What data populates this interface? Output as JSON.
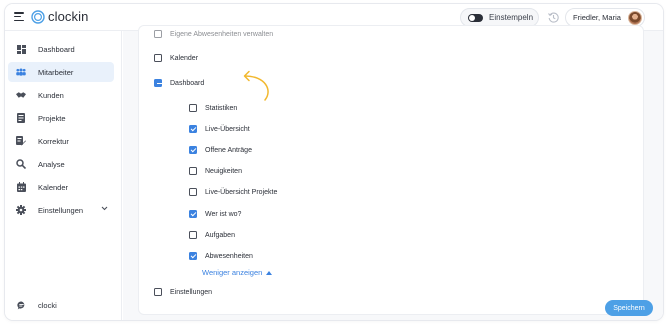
{
  "app": {
    "name": "clockin"
  },
  "header": {
    "clock_in_label": "Einstempeln",
    "user_name": "Friedler, Maria"
  },
  "sidebar": {
    "items": [
      {
        "label": "Dashboard",
        "icon": "dashboard-icon",
        "active": false
      },
      {
        "label": "Mitarbeiter",
        "icon": "users-icon",
        "active": true
      },
      {
        "label": "Kunden",
        "icon": "handshake-icon",
        "active": false
      },
      {
        "label": "Projekte",
        "icon": "projects-icon",
        "active": false
      },
      {
        "label": "Korrektur",
        "icon": "correction-icon",
        "active": false
      },
      {
        "label": "Analyse",
        "icon": "analysis-icon",
        "active": false
      },
      {
        "label": "Kalender",
        "icon": "calendar-icon",
        "active": false
      },
      {
        "label": "Einstellungen",
        "icon": "gear-icon",
        "active": false
      }
    ],
    "footer_label": "clocki"
  },
  "permissions": {
    "top_cut_label": "Eigene Abwesenheiten verwalten",
    "kalender": {
      "label": "Kalender",
      "checked": false
    },
    "dashboard": {
      "label": "Dashboard",
      "state": "partial"
    },
    "dashboard_children": [
      {
        "label": "Statistiken",
        "checked": false
      },
      {
        "label": "Live-Übersicht",
        "checked": true
      },
      {
        "label": "Offene Anträge",
        "checked": true
      },
      {
        "label": "Neuigkeiten",
        "checked": false
      },
      {
        "label": "Live-Übersicht Projekte",
        "checked": false
      },
      {
        "label": "Wer ist wo?",
        "checked": true
      },
      {
        "label": "Aufgaben",
        "checked": false
      },
      {
        "label": "Abwesenheiten",
        "checked": true
      }
    ],
    "show_less_label": "Weniger anzeigen",
    "einstellungen": {
      "label": "Einstellungen",
      "checked": false
    }
  },
  "actions": {
    "save_label": "Speichern"
  },
  "colors": {
    "accent": "#3b82e0",
    "active_nav_bg": "#e9f1fb",
    "annotation_arrow": "#f2b82e"
  }
}
